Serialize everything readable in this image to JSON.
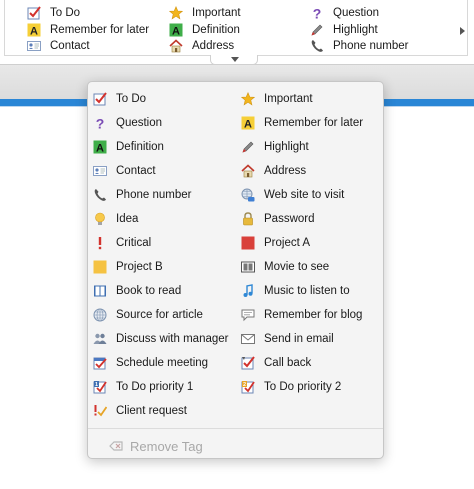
{
  "gallery": {
    "items": [
      {
        "label": "To Do",
        "icon": "todo-checkbox-icon"
      },
      {
        "label": "Important",
        "icon": "star-icon"
      },
      {
        "label": "Question",
        "icon": "question-icon"
      },
      {
        "label": "Remember for later",
        "icon": "remember-a-icon"
      },
      {
        "label": "Definition",
        "icon": "definition-a-icon"
      },
      {
        "label": "Highlight",
        "icon": "highlight-pen-icon"
      },
      {
        "label": "Contact",
        "icon": "contact-card-icon"
      },
      {
        "label": "Address",
        "icon": "house-icon"
      },
      {
        "label": "Phone number",
        "icon": "phone-icon"
      }
    ]
  },
  "menu": {
    "items": [
      {
        "label": "To Do",
        "icon": "todo-checkbox-icon"
      },
      {
        "label": "Important",
        "icon": "star-icon"
      },
      {
        "label": "Question",
        "icon": "question-icon"
      },
      {
        "label": "Remember for later",
        "icon": "remember-a-icon"
      },
      {
        "label": "Definition",
        "icon": "definition-a-icon"
      },
      {
        "label": "Highlight",
        "icon": "highlight-pen-icon"
      },
      {
        "label": "Contact",
        "icon": "contact-card-icon"
      },
      {
        "label": "Address",
        "icon": "house-icon"
      },
      {
        "label": "Phone number",
        "icon": "phone-icon"
      },
      {
        "label": "Web site to visit",
        "icon": "globe-link-icon"
      },
      {
        "label": "Idea",
        "icon": "lightbulb-icon"
      },
      {
        "label": "Password",
        "icon": "lock-icon"
      },
      {
        "label": "Critical",
        "icon": "exclamation-icon"
      },
      {
        "label": "Project A",
        "icon": "red-square-icon"
      },
      {
        "label": "Project B",
        "icon": "yellow-square-icon"
      },
      {
        "label": "Movie to see",
        "icon": "film-icon"
      },
      {
        "label": "Book to read",
        "icon": "book-icon"
      },
      {
        "label": "Music to listen to",
        "icon": "music-note-icon"
      },
      {
        "label": "Source for article",
        "icon": "globe-icon"
      },
      {
        "label": "Remember for blog",
        "icon": "speech-bubble-icon"
      },
      {
        "label": "Discuss with manager",
        "icon": "people-icon"
      },
      {
        "label": "Send in email",
        "icon": "email-icon"
      },
      {
        "label": "Schedule meeting",
        "icon": "calendar-check-icon"
      },
      {
        "label": "Call back",
        "icon": "callback-check-icon"
      },
      {
        "label": "To Do priority 1",
        "icon": "priority-1-icon"
      },
      {
        "label": "To Do priority 2",
        "icon": "priority-2-icon"
      },
      {
        "label": "Client request",
        "icon": "client-request-icon"
      }
    ],
    "remove_label": "Remove Tag"
  },
  "colors": {
    "accent_blue": "#2a86d6",
    "check_red": "#d2322d",
    "star_gold": "#f2b51c",
    "question_purple": "#7a4bb5",
    "definition_green": "#3fae49",
    "remember_yellow": "#f6cf37",
    "project_a_red": "#d9403a",
    "project_b_yellow": "#f5c242"
  }
}
